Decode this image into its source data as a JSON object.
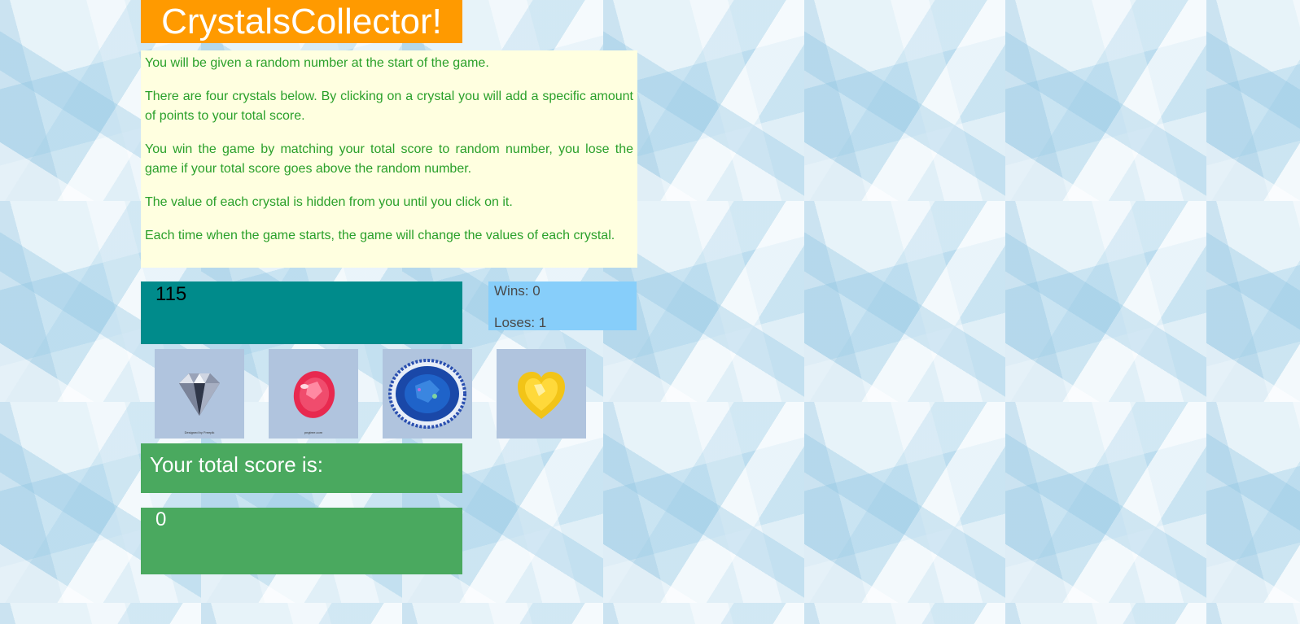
{
  "title": "CrystalsCollector!",
  "instructions": [
    "You will be given a random number at the start of the game.",
    "There are four crystals below. By clicking on a crystal you will add a specific amount of points to your total score.",
    "You win the game by matching your total score to random number, you lose the game if your total score goes above the random number.",
    "The value of each crystal is hidden from you until you click on it.",
    "Each time when the game starts, the game will change the values of each crystal."
  ],
  "random_number": "115",
  "scoreboard": {
    "wins": "Wins: 0",
    "losses": "Loses: 1"
  },
  "crystals": [
    {
      "icon": "white-diamond-icon",
      "caption": "Designed by Freepik"
    },
    {
      "icon": "red-ruby-icon",
      "caption": "pngtree.com"
    },
    {
      "icon": "blue-oval-gem-icon"
    },
    {
      "icon": "yellow-heart-gem-icon"
    }
  ],
  "total_score_label": "Your total score is:",
  "total_score": "0",
  "colors": {
    "title_bg": "#ff9a00",
    "instructions_bg": "#ffffe0",
    "instructions_text": "#2aa02a",
    "target_bg": "#008b8b",
    "scoreboard_bg": "#87cefa",
    "crystal_bg": "#b0c4de",
    "score_bg": "#4aa95f"
  }
}
